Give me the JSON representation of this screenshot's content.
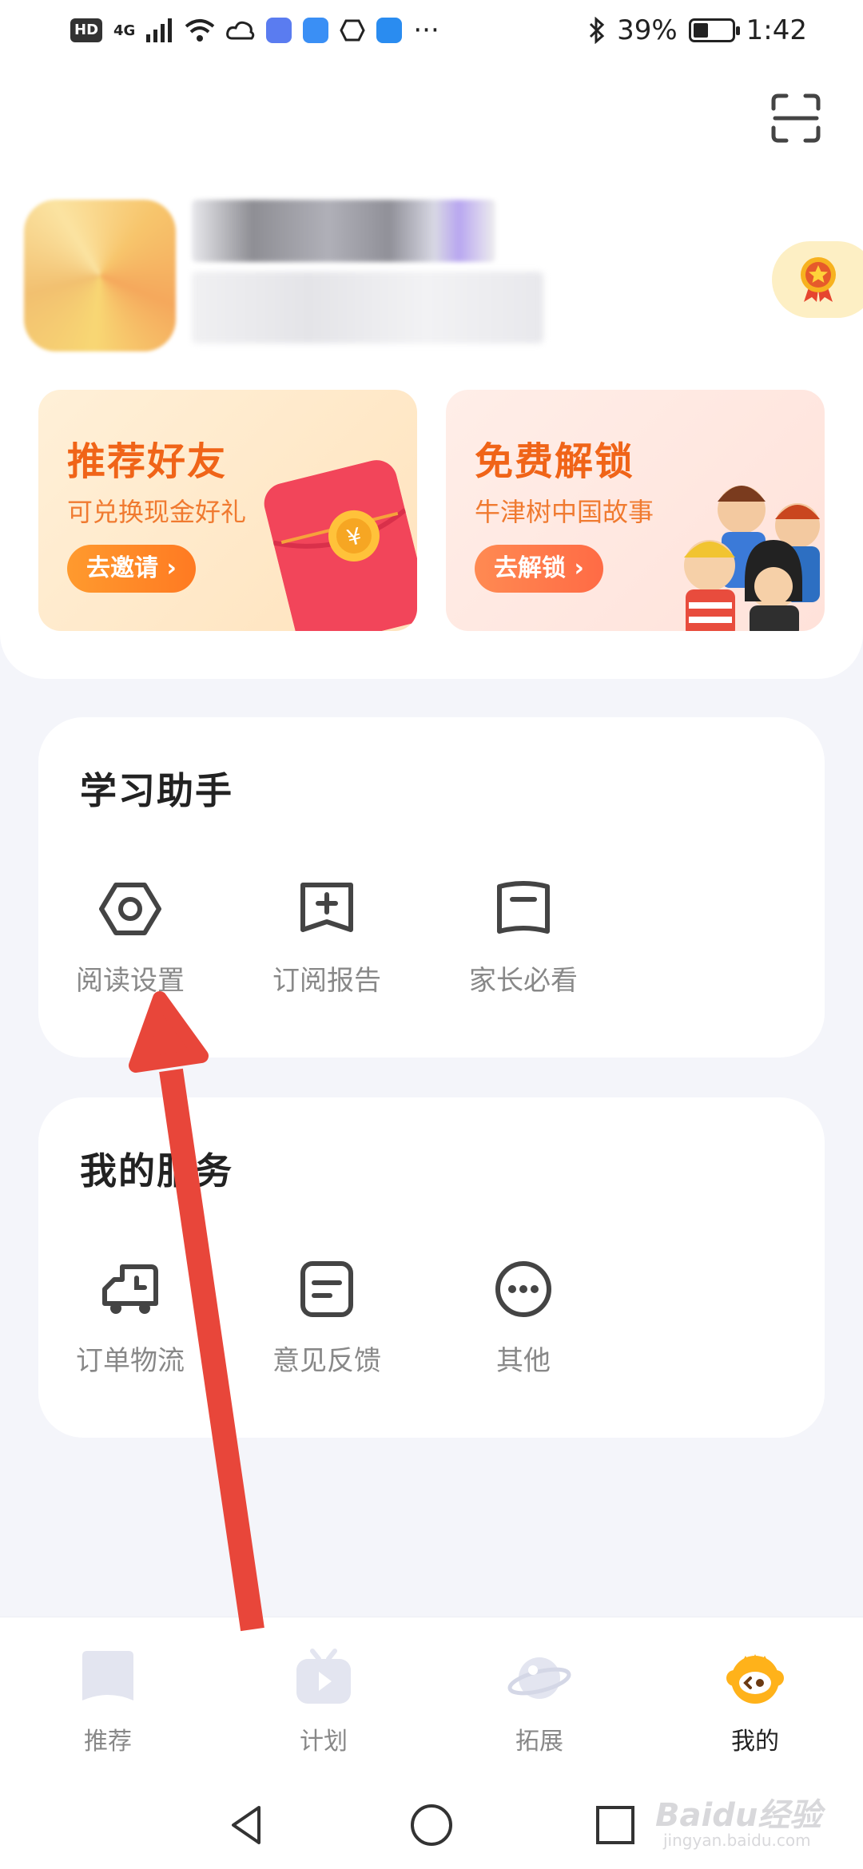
{
  "status_bar": {
    "net_type": "HD",
    "signal": "4G",
    "more": "···",
    "battery": "39%",
    "battery_level": 0.39,
    "time": "1:42"
  },
  "promos": [
    {
      "title": "推荐好友",
      "subtitle": "可兑换现金好礼",
      "button": "去邀请 ›"
    },
    {
      "title": "免费解锁",
      "subtitle": "牛津树中国故事",
      "button": "去解锁 ›"
    }
  ],
  "study": {
    "title": "学习助手",
    "items": [
      {
        "label": "阅读设置",
        "icon": "hexagon-settings-icon"
      },
      {
        "label": "订阅报告",
        "icon": "report-add-icon"
      },
      {
        "label": "家长必看",
        "icon": "parent-book-icon"
      }
    ]
  },
  "services": {
    "title": "我的服务",
    "items": [
      {
        "label": "订单物流",
        "icon": "delivery-truck-icon"
      },
      {
        "label": "意见反馈",
        "icon": "feedback-note-icon"
      },
      {
        "label": "其他",
        "icon": "more-dots-icon"
      }
    ]
  },
  "nav": {
    "items": [
      {
        "label": "推荐",
        "icon": "recommend-icon"
      },
      {
        "label": "计划",
        "icon": "plan-tv-icon"
      },
      {
        "label": "拓展",
        "icon": "planet-icon"
      },
      {
        "label": "我的",
        "icon": "mascot-icon",
        "active": true
      }
    ]
  },
  "colors": {
    "accent_orange": "#f06418",
    "active_nav": "#ffb21a",
    "annotation_arrow": "#e8463a"
  },
  "watermark": {
    "main": "Baidu经验",
    "sub": "jingyan.baidu.com"
  }
}
